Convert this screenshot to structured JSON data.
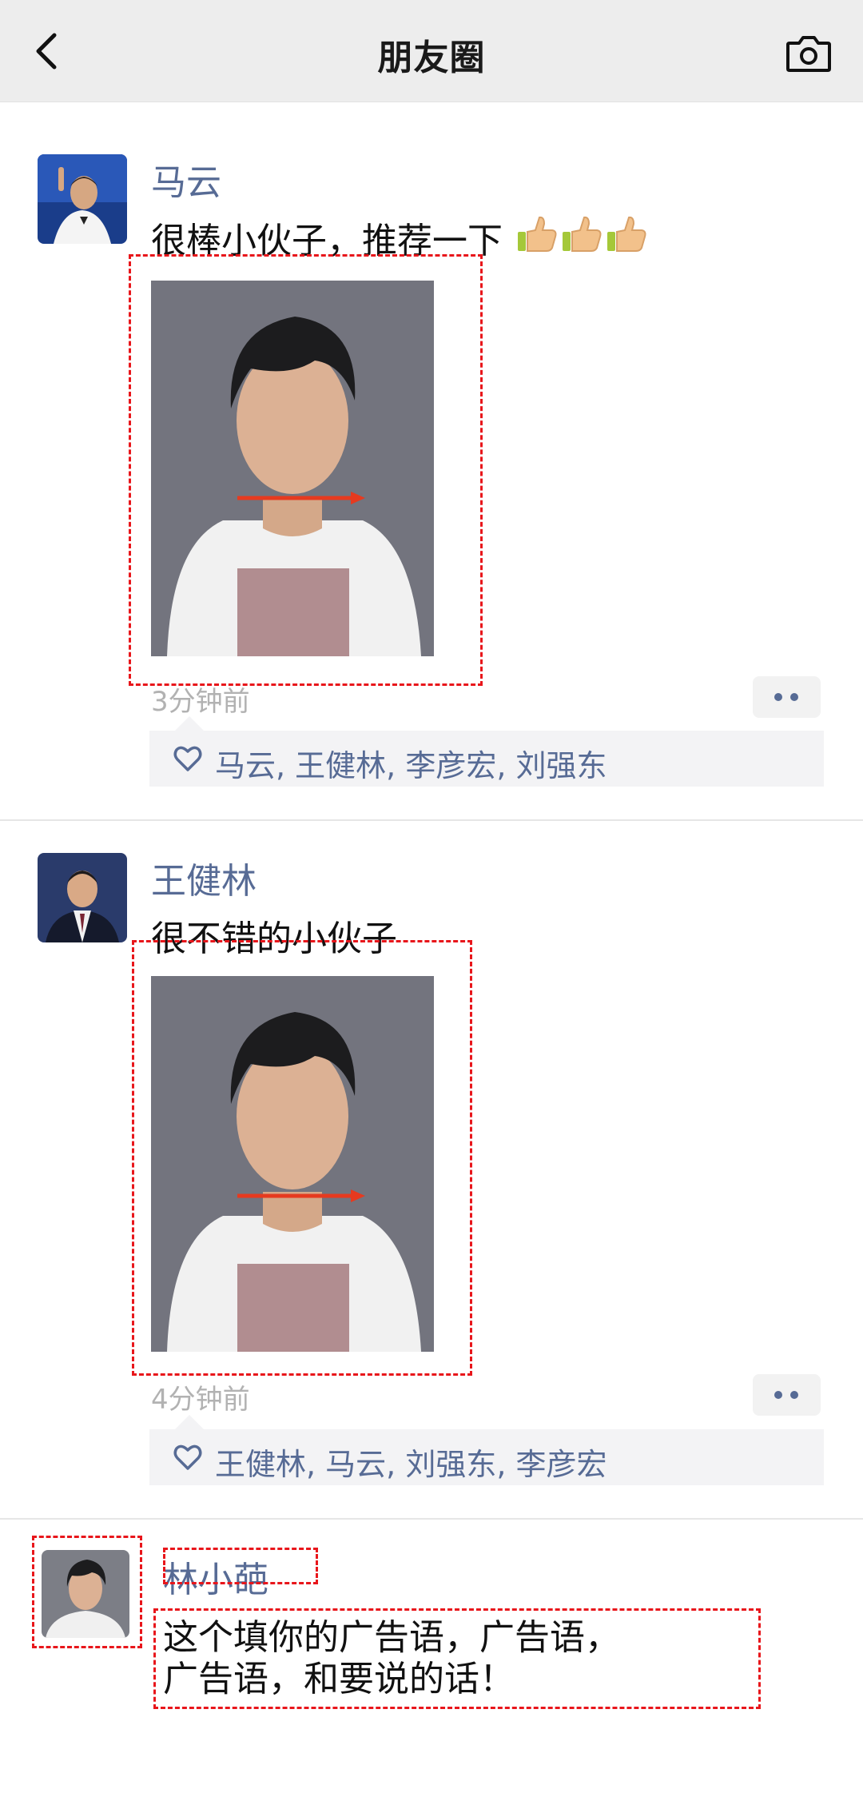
{
  "header": {
    "title": "朋友圈",
    "back_icon": "chevron-left-icon",
    "camera_icon": "camera-icon"
  },
  "posts": [
    {
      "author": "马云",
      "text": "很棒小伙子，推荐一下",
      "emoji": "👍👍👍",
      "time": "3分钟前",
      "likes": "马云, 王健林, 李彦宏, 刘强东"
    },
    {
      "author": "王健林",
      "text": "很不错的小伙子",
      "time": "4分钟前",
      "likes": "王健林, 马云, 刘强东, 李彦宏"
    },
    {
      "author": "林小葩",
      "text_line1": "这个填你的广告语，广告语，",
      "text_line2": "广告语，和要说的话！"
    }
  ],
  "colors": {
    "link_blue": "#576b95",
    "annotation_red": "#e8161b",
    "header_bg": "#ededed"
  }
}
